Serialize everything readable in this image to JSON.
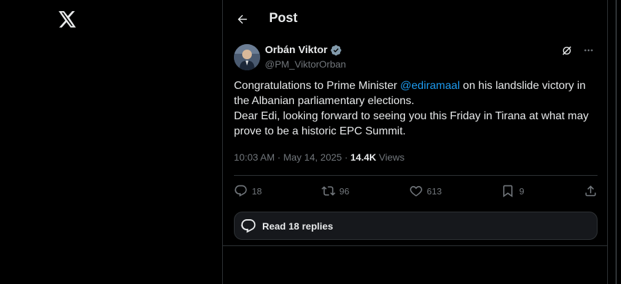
{
  "app": {
    "logo": "x-logo-icon"
  },
  "header": {
    "title": "Post",
    "back_icon": "arrow-left-icon"
  },
  "post": {
    "author_name": "Orbán Viktor",
    "handle": "@PM_ViktorOrban",
    "verified": true,
    "text_before_mention": "Congratulations to Prime Minister ",
    "mention": "@ediramaal",
    "text_line1_after": " on his landslide victory in",
    "text_line2": "the Albanian parliamentary elections.",
    "text_line3": "Dear Edi, looking forward to seeing you this Friday in Tirana at what may",
    "text_line4": "prove to be a historic EPC Summit.",
    "timestamp": "10:03 AM · May 14, 2025 · ",
    "views_count": "14.4K",
    "views_label": " Views"
  },
  "actions": {
    "replies": "18",
    "reposts": "96",
    "likes": "613",
    "bookmarks": "9"
  },
  "read_replies": {
    "label": "Read 18 replies"
  },
  "colors": {
    "accent": "#1d9bf0",
    "muted": "#71767b",
    "text": "#e7e9ea",
    "bg": "#000000",
    "border": "#2f3336"
  }
}
